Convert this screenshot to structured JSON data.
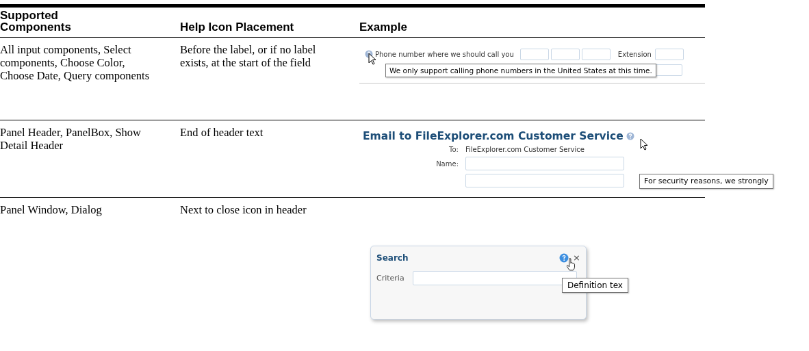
{
  "table": {
    "columns": [
      "Supported Components",
      "Help Icon Placement",
      "Example"
    ],
    "rows": [
      {
        "components": "All input components, Select components, Choose Color, Choose Date, Query components",
        "placement": "Before the label, or if no label exists, at the start of the field",
        "example": {
          "kind": "field",
          "label": "Phone number where we should call you",
          "extension_label": "Extension",
          "tooltip": "We only support calling phone numbers in the United States at this time."
        }
      },
      {
        "components": "Panel Header, PanelBox, Show Detail Header",
        "placement": "End of header text",
        "example": {
          "kind": "header",
          "title": "Email to FileExplorer.com Customer Service",
          "to_label": "To:",
          "to_value": "FileExplorer.com Customer Service",
          "name_label": "Name:",
          "tooltip": "For security reasons, we strongly"
        }
      },
      {
        "components": "Panel Window, Dialog",
        "placement": "Next to close icon in header",
        "example": {
          "kind": "dialog",
          "title": "Search",
          "close": "×",
          "label": "Criteria",
          "tooltip": "Definition tex"
        }
      }
    ]
  }
}
